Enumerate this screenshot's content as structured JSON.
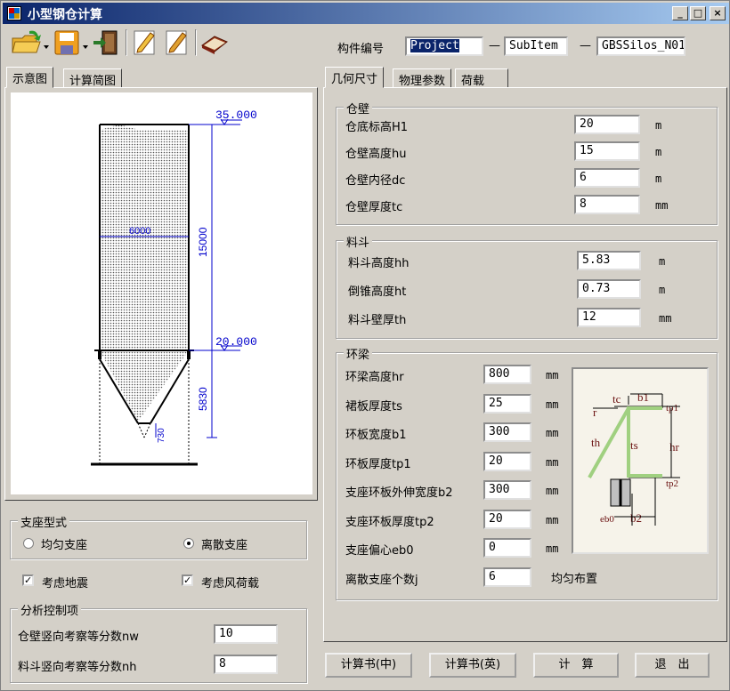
{
  "window": {
    "title": "小型钢仓计算"
  },
  "toolbar": {
    "component_no_label": "构件编号",
    "project": "Project",
    "sep1": "—",
    "subitem": "SubItem",
    "sep2": "—",
    "name": "GBSSilos_N01"
  },
  "left_tabs": [
    "示意图",
    "计算简图"
  ],
  "diagram": {
    "top_elev": "35.000",
    "mid_elev": "20.000",
    "width": "6000",
    "wall_height": "15000",
    "hopper_height": "5830",
    "cone": "730"
  },
  "support": {
    "title": "支座型式",
    "opt1": "均匀支座",
    "opt2": "离散支座",
    "selected": "离散支座"
  },
  "checks": {
    "seismic": "考虑地震",
    "wind": "考虑风荷载",
    "seismic_on": true,
    "wind_on": true
  },
  "analysis": {
    "title": "分析控制项",
    "nw_label": "仓壁竖向考察等分数nw",
    "nw": "10",
    "nh_label": "料斗竖向考察等分数nh",
    "nh": "8"
  },
  "right_tabs": [
    "几何尺寸",
    "物理参数",
    "荷载"
  ],
  "wall": {
    "title": "仓壁",
    "rows": [
      {
        "label": "仓底标高H1",
        "value": "20",
        "unit": "m"
      },
      {
        "label": "仓壁高度hu",
        "value": "15",
        "unit": "m"
      },
      {
        "label": "仓壁内径dc",
        "value": "6",
        "unit": "m"
      },
      {
        "label": "仓壁厚度tc",
        "value": "8",
        "unit": "mm"
      }
    ]
  },
  "hopper": {
    "title": "料斗",
    "rows": [
      {
        "label": "料斗高度hh",
        "value": "5.83",
        "unit": "m"
      },
      {
        "label": "倒锥高度ht",
        "value": "0.73",
        "unit": "m"
      },
      {
        "label": "料斗壁厚th",
        "value": "12",
        "unit": "mm"
      }
    ]
  },
  "ring": {
    "title": "环梁",
    "rows": [
      {
        "label": "环梁高度hr",
        "value": "800",
        "unit": "mm"
      },
      {
        "label": "裙板厚度ts",
        "value": "25",
        "unit": "mm"
      },
      {
        "label": "环板宽度b1",
        "value": "300",
        "unit": "mm"
      },
      {
        "label": "环板厚度tp1",
        "value": "20",
        "unit": "mm"
      },
      {
        "label": "支座环板外伸宽度b2",
        "value": "300",
        "unit": "mm"
      },
      {
        "label": "支座环板厚度tp2",
        "value": "20",
        "unit": "mm"
      },
      {
        "label": "支座偏心eb0",
        "value": "0",
        "unit": "mm"
      },
      {
        "label": "离散支座个数j",
        "value": "6",
        "unit": "均匀布置"
      }
    ]
  },
  "ring_fig": {
    "r": "r",
    "tc": "tc",
    "b1": "b1",
    "tp1": "tp1",
    "th": "th",
    "ts": "ts",
    "hr": "hr",
    "tp2": "tp2",
    "eb0": "eb0",
    "b2": "b2"
  },
  "buttons": {
    "calc_cn": "计算书(中)",
    "calc_en": "计算书(英)",
    "compute": "计　算",
    "exit": "退　出"
  },
  "colors": {
    "titlebar": "#0a246a",
    "dim": "#0000cc",
    "beam": "#a0d080"
  }
}
